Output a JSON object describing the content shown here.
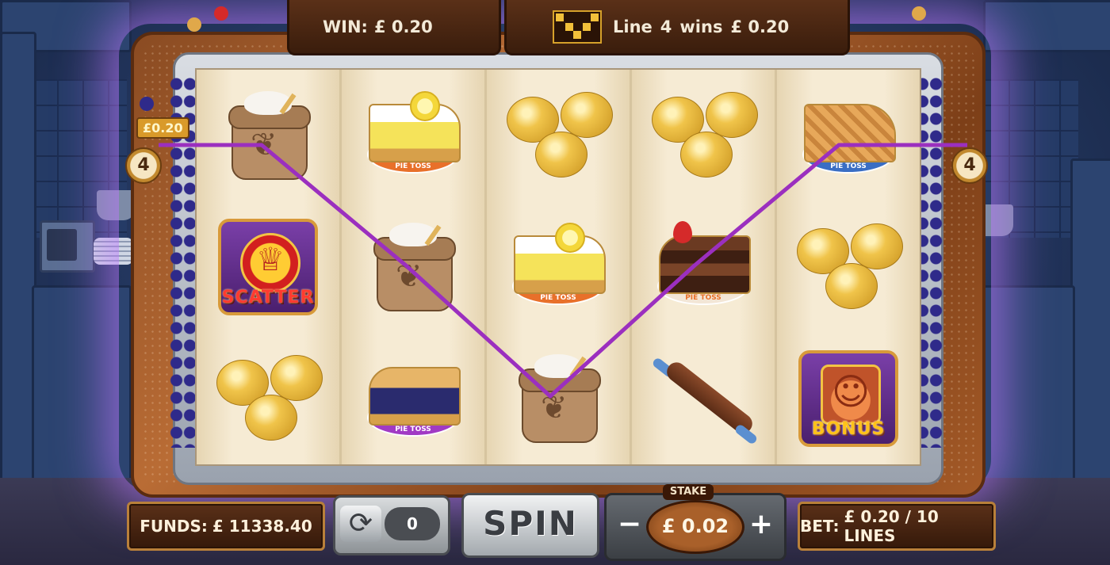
{
  "header": {
    "win_label": "WIN:",
    "win_value": "£ 0.20",
    "line_label": "Line",
    "line_number": "4",
    "line_wins_label": "wins",
    "line_wins_value": "£ 0.20"
  },
  "payline": {
    "number": "4",
    "win_amount": "£0.20",
    "color": "#9b2fbf"
  },
  "reels": [
    [
      {
        "symbol": "flour-sack",
        "plate_text": ""
      },
      {
        "symbol": "scatter",
        "label": "SCATTER"
      },
      {
        "symbol": "eggs",
        "plate_text": ""
      }
    ],
    [
      {
        "symbol": "lemon-meringue-pie",
        "plate_text": "PIE TOSS"
      },
      {
        "symbol": "flour-sack",
        "plate_text": ""
      },
      {
        "symbol": "blueberry-pie",
        "plate_text": "PIE TOSS"
      }
    ],
    [
      {
        "symbol": "eggs",
        "plate_text": ""
      },
      {
        "symbol": "lemon-meringue-pie",
        "plate_text": "PIE TOSS"
      },
      {
        "symbol": "flour-sack",
        "plate_text": ""
      }
    ],
    [
      {
        "symbol": "eggs",
        "plate_text": ""
      },
      {
        "symbol": "chocolate-cake",
        "plate_text": "PIE TOSS"
      },
      {
        "symbol": "rolling-pin",
        "plate_text": ""
      }
    ],
    [
      {
        "symbol": "apple-pie",
        "plate_text": "PIE TOSS"
      },
      {
        "symbol": "eggs",
        "plate_text": ""
      },
      {
        "symbol": "bonus",
        "label": "BONUS"
      }
    ]
  ],
  "controls": {
    "funds_label": "FUNDS:",
    "funds_value": "£ 11338.40",
    "autoplay_count": "0",
    "spin_label": "SPIN",
    "stake_label": "STAKE",
    "stake_value": "£ 0.02",
    "stake_minus": "−",
    "stake_plus": "+",
    "bet_label": "BET:",
    "bet_value": "£ 0.20 / 10 LINES"
  },
  "colors": {
    "glow": "#be78ff",
    "payline": "#9b2fbf",
    "frame_wood": "#b96c35"
  }
}
